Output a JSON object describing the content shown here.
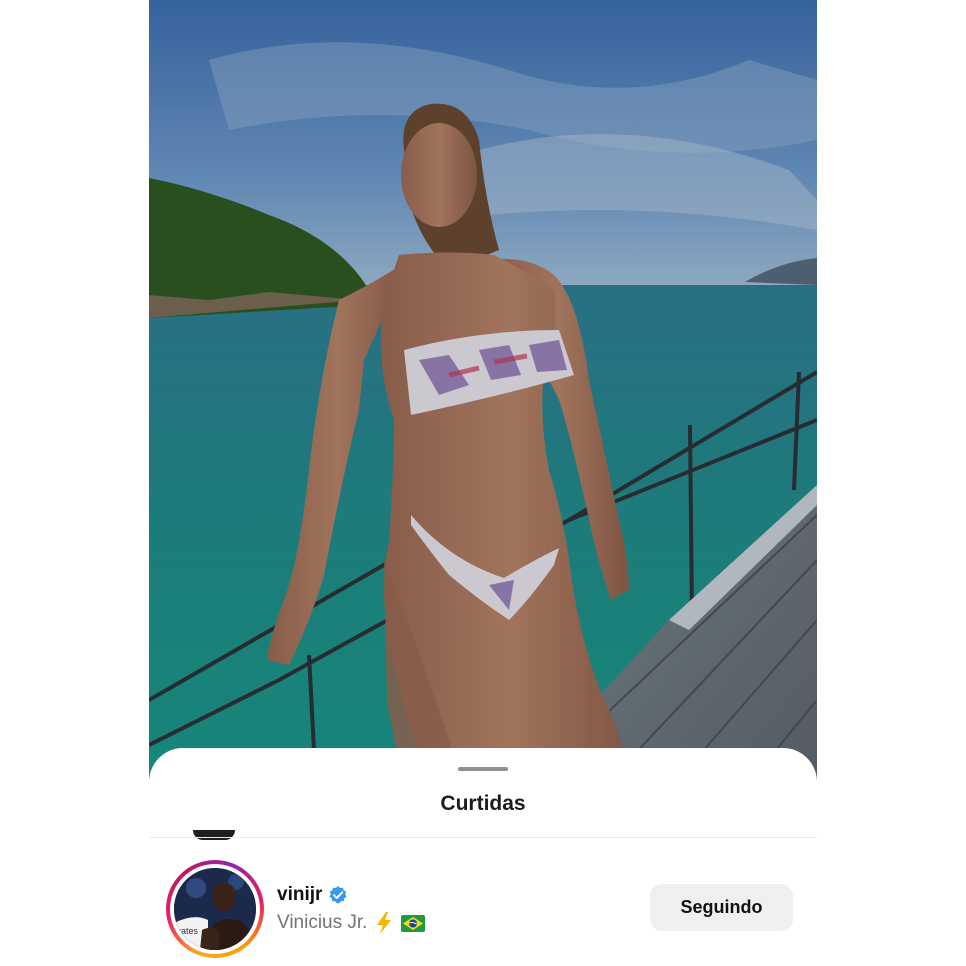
{
  "post": {
    "image_description_icon": "photo-post-image"
  },
  "likes_sheet": {
    "title": "Curtidas"
  },
  "liker": {
    "username": "vinijr",
    "verified_icon": "verified-badge-icon",
    "full_name": "Vinicius Jr.",
    "emoji_1": "lightning-bolt-emoji",
    "emoji_2": "brazil-flag-emoji",
    "follow_button_label": "Seguindo"
  },
  "colors": {
    "sheet_background": "#ffffff",
    "button_background": "#efefef",
    "verified_blue": "#3897f0",
    "story_ring_start": "#f9a825",
    "story_ring_end": "#c2185b"
  }
}
